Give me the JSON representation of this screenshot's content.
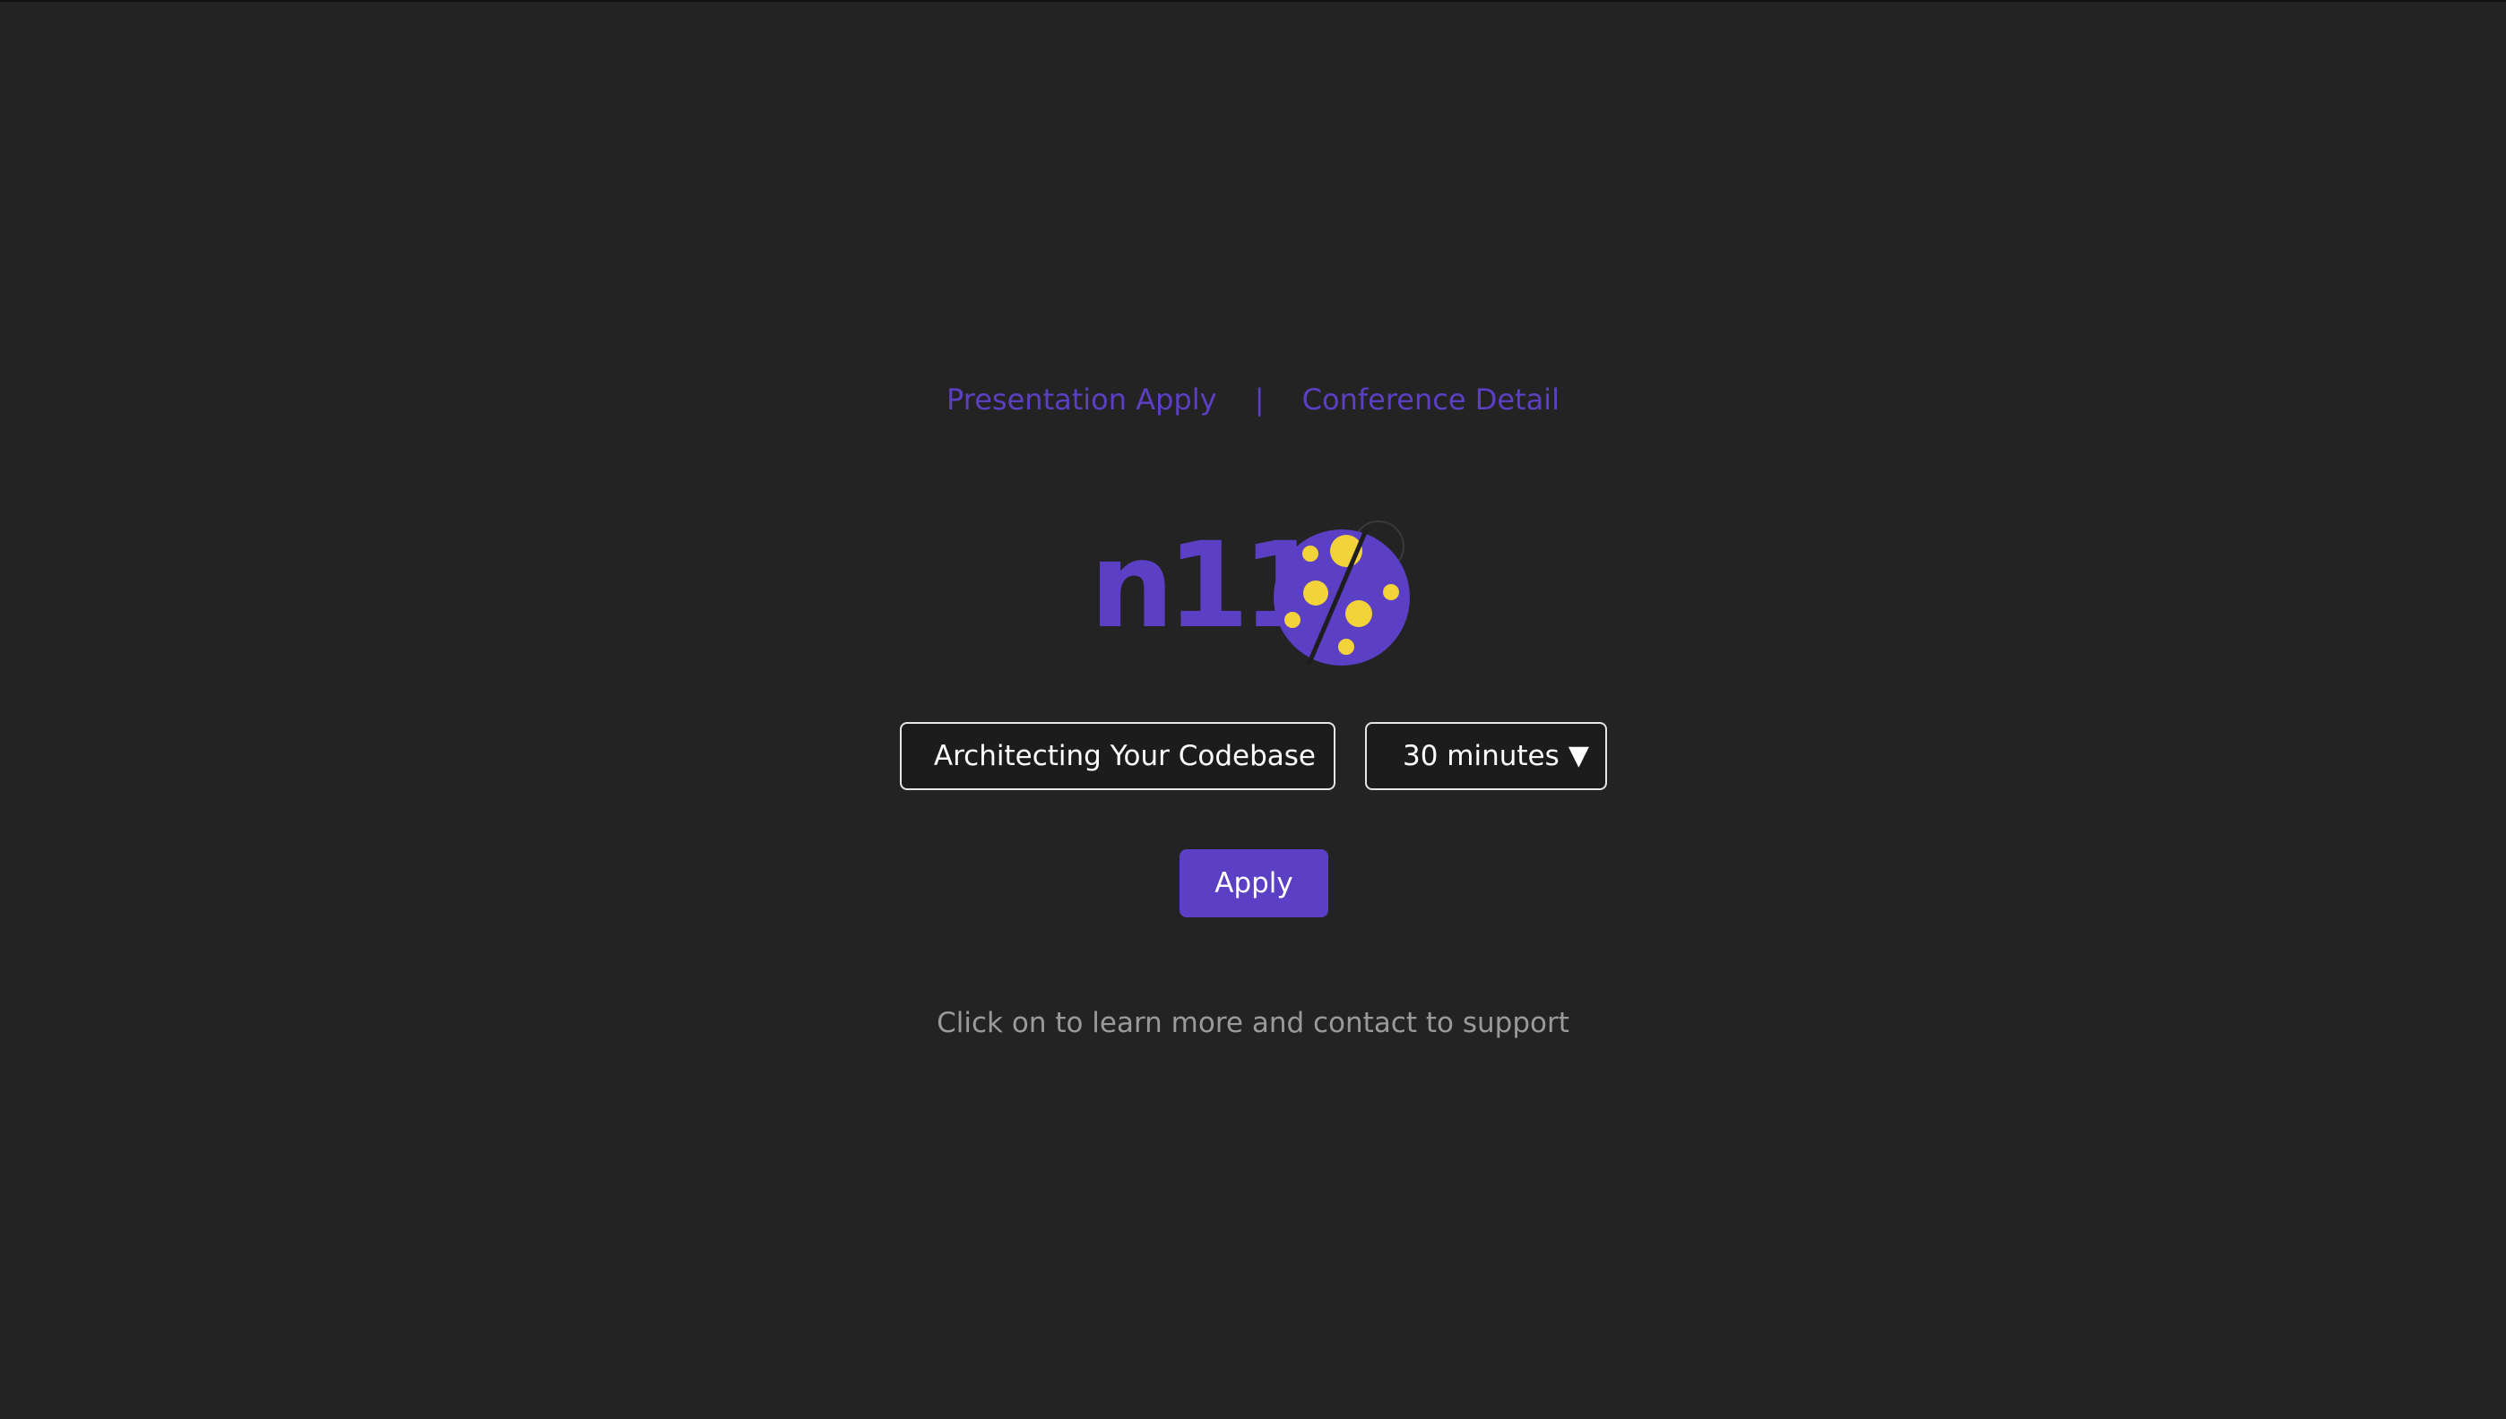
{
  "nav": {
    "presentation_apply": "Presentation Apply",
    "separator": "|",
    "conference_detail": "Conference Detail"
  },
  "logo": {
    "text": "n11",
    "brand_color": "#5b3fc4",
    "accent_color": "#f2d33a"
  },
  "form": {
    "title_value": "Architecting Your Codebase",
    "duration_selected": "30 minutes",
    "apply_label": "Apply"
  },
  "footer": {
    "text": "Click on to learn more and contact to support"
  }
}
